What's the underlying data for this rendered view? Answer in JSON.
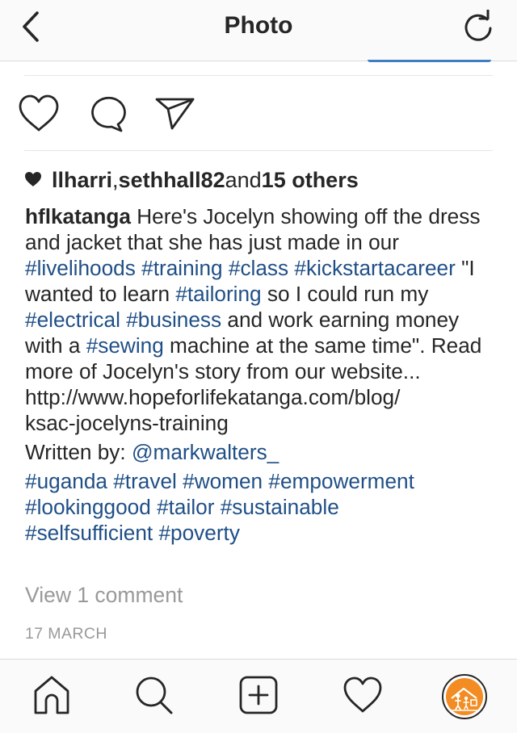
{
  "navbar": {
    "title": "Photo",
    "back_icon": "chevron-left-icon",
    "refresh_icon": "refresh-icon"
  },
  "actions": {
    "like_icon": "heart-icon",
    "comment_icon": "comment-bubble-icon",
    "share_icon": "paper-plane-icon"
  },
  "likes": {
    "user1": "llharri",
    "separator": ", ",
    "user2": "sethhall82",
    "and_text": " and ",
    "others": "15 others"
  },
  "caption": {
    "username": "hflkatanga",
    "t1": " Here's Jocelyn showing off the dress and jacket that she has just made in our ",
    "h1": "#livelihoods",
    "h2": "#training",
    "h3": "#class",
    "h4": "#kickstartacareer",
    "t2": " \"I wanted to learn ",
    "h5": "#tailoring",
    "t3": " so I could run my ",
    "h6": "#electrical",
    "h7": "#business",
    "t4": " and work earning money with a ",
    "h8": "#sewing",
    "t5": " machine at the same time\". Read more of Jocelyn's story from our website...",
    "url1": "http://www.hopeforlifekatanga.com/blog/",
    "url2": "ksac-jocelyns-training",
    "written_by": "Written by: ",
    "mention": "@markwalters_",
    "tags_line1": [
      "#uganda",
      "#travel",
      "#women",
      "#empowerment"
    ],
    "tags_line2": [
      "#lookinggood",
      "#tailor",
      "#sustainable"
    ],
    "tags_line3": [
      "#selfsufficient",
      "#poverty"
    ]
  },
  "comments": {
    "view_label": "View 1 comment"
  },
  "timestamp": "17 MARCH",
  "tabbar": {
    "home_icon": "home-icon",
    "search_icon": "search-icon",
    "add_icon": "add-post-icon",
    "activity_icon": "heart-icon",
    "profile": "profile-avatar"
  },
  "colors": {
    "hashtag": "#1f4f86",
    "text": "#262626",
    "muted": "#999999",
    "avatar_bg": "#f28c23",
    "bar_bg": "#fafafa",
    "border": "#dbdbdb"
  }
}
